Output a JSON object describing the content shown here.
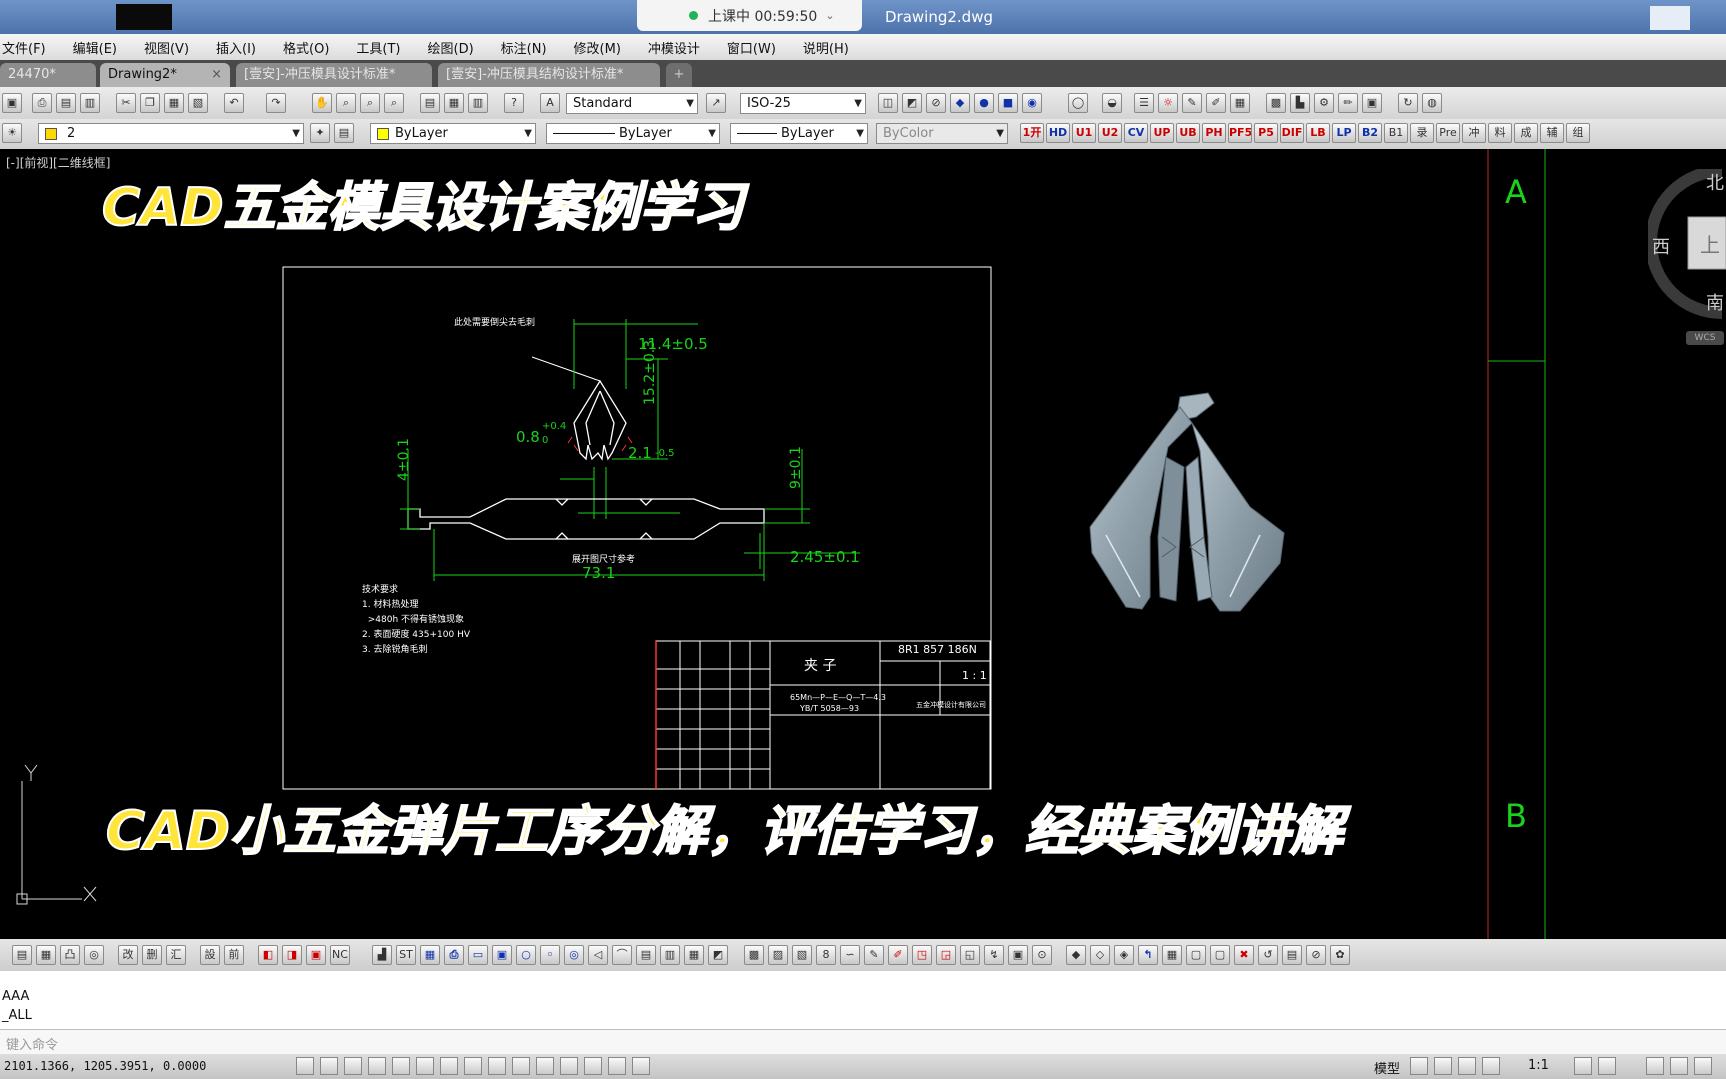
{
  "app": {
    "live_status": "上课中 00:59:50",
    "document_title": "Drawing2.dwg"
  },
  "menu": [
    "文件(F)",
    "编辑(E)",
    "视图(V)",
    "插入(I)",
    "格式(O)",
    "工具(T)",
    "绘图(D)",
    "标注(N)",
    "修改(M)",
    "冲模设计",
    "窗口(W)",
    "说明(H)"
  ],
  "tabs": [
    {
      "label": "24470*",
      "active": false
    },
    {
      "label": "Drawing2*",
      "active": true
    },
    {
      "label": "[壹安]-冲压模具设计标准*",
      "active": false
    },
    {
      "label": "[壹安]-冲压模具结构设计标准*",
      "active": false
    }
  ],
  "toolbar": {
    "text_style": "Standard",
    "dim_style": "ISO-25",
    "layer": "2",
    "color": "ByLayer",
    "linetype": "ByLayer",
    "lineweight": "ByLayer",
    "plotstyle": "ByColor",
    "custom_buttons": [
      "1开",
      "HD",
      "U1",
      "U2",
      "CV",
      "UP",
      "UB",
      "PH",
      "PF5",
      "P5",
      "DIF",
      "LB",
      "LP",
      "B2",
      "B1",
      "录",
      "Pre",
      "冲",
      "料",
      "成",
      "辅",
      "组"
    ]
  },
  "viewport": {
    "label": "[-][前视][二维线框]",
    "overlay_top": "CAD五金模具设计案例学习",
    "overlay_bottom": "CAD小五金弹片工序分解，评估学习，经典案例讲解",
    "grid_letters": [
      "A",
      "B"
    ],
    "compass": {
      "north": "北",
      "west": "西",
      "south": "南",
      "top": "上",
      "wcs": "WCS"
    }
  },
  "drawing": {
    "note_top": "此处需要倒尖去毛刺",
    "dims": {
      "d1": "11.4±0.5",
      "d2": "15.2±0.3",
      "d3": "0.8",
      "d3_tol": "+0.4",
      "d3_tol2": "0",
      "d4": "2.1",
      "d4_tol": "-0.5",
      "d5": "4±0.1",
      "d6": "9±0.1",
      "d7": "2.45±0.1",
      "d8": "73.1"
    },
    "center_label": "展开图尺寸参考",
    "tech_notes": [
      "技术要求",
      "1. 材料热处理",
      "  >480h 不得有锈蚀现象",
      "2. 表面硬度 435+100 HV",
      "3. 去除锐角毛刺"
    ],
    "title_block": {
      "part_name": "夹 子",
      "drawing_no": "8R1 857 186N",
      "scale": "1 : 1",
      "material_line1": "65Mn—P—E—Q—T—4.3",
      "material_line2": "YB/T 5058—93",
      "company": "五金冲模设计有限公司"
    }
  },
  "command": {
    "history": [
      "AAA",
      "_ALL"
    ],
    "prompt": "键入命令"
  },
  "status": {
    "coords": "2101.1366, 1205.3951, 0.0000",
    "model_tab": "模型",
    "scale": "1:1"
  },
  "colors": {
    "dim_green": "#19d219",
    "drawing_white": "#ffffff",
    "overlay_yellow": "#ffe43a"
  }
}
